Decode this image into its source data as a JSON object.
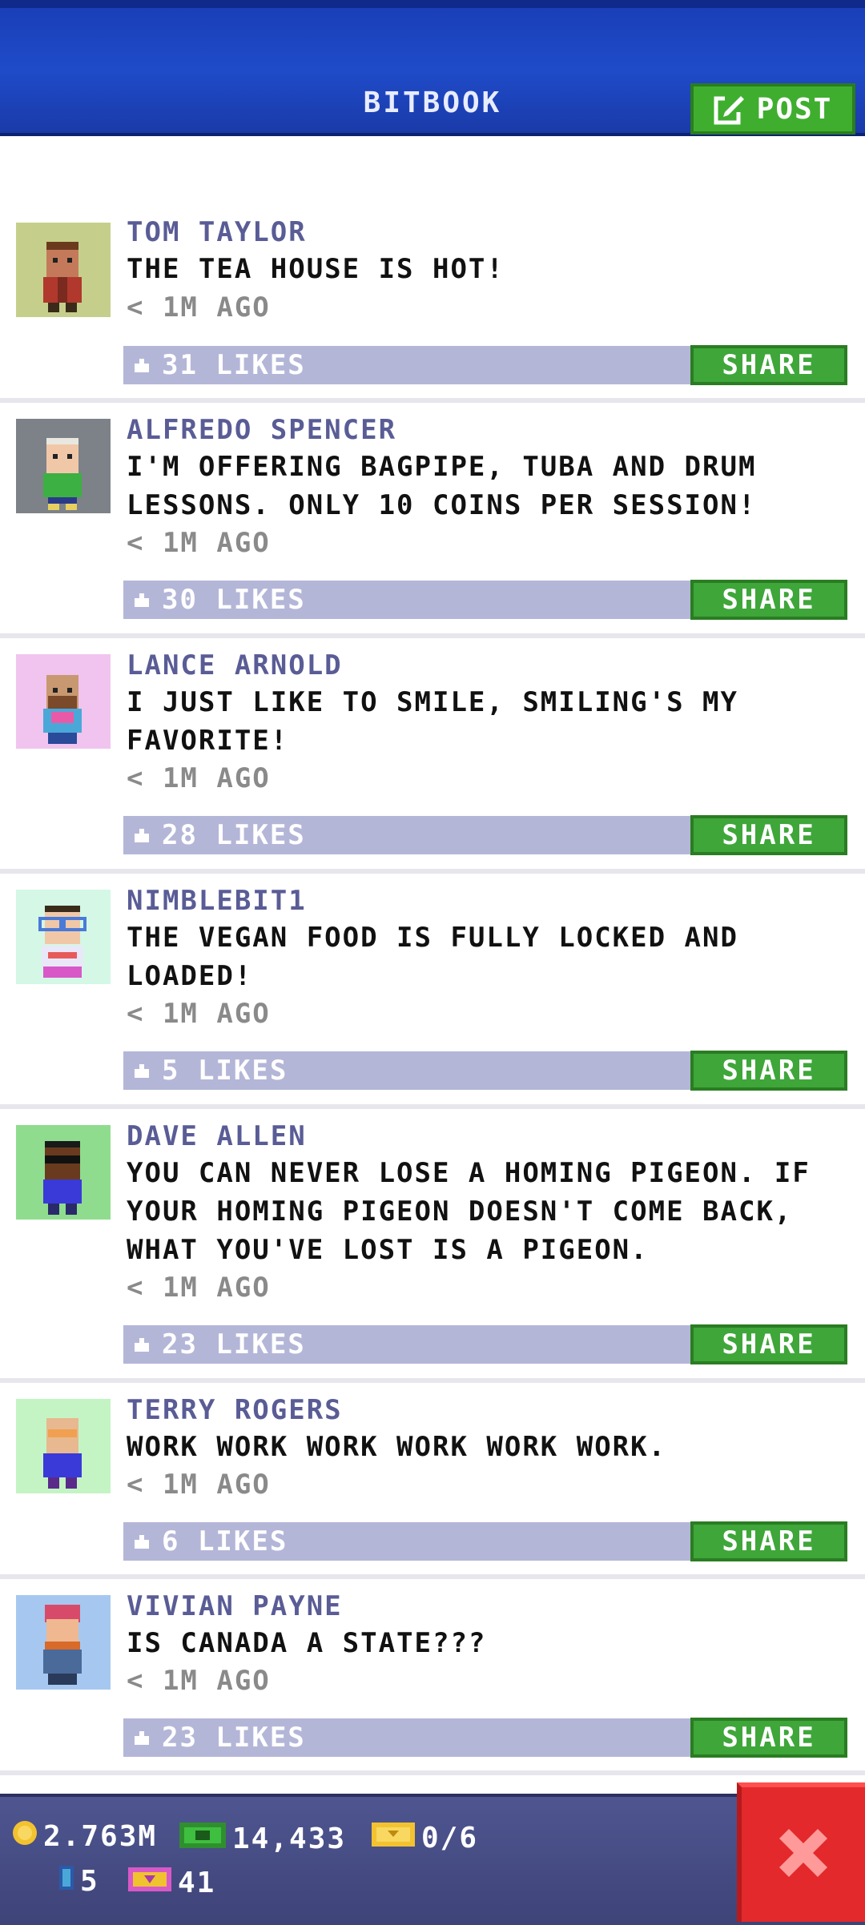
{
  "header": {
    "title": "BITBOOK",
    "post_label": "POST"
  },
  "posts": [
    {
      "name": "TOM TAYLOR",
      "message": "THE TEA HOUSE IS HOT!",
      "time": "< 1M AGO",
      "likes": "31 LIKES",
      "share": "SHARE",
      "avatar_bg": "#c5cf8b"
    },
    {
      "name": "ALFREDO SPENCER",
      "message": "I'M OFFERING BAGPIPE, TUBA AND DRUM\nLESSONS. ONLY 10 COINS PER SESSION!",
      "time": "< 1M AGO",
      "likes": "30 LIKES",
      "share": "SHARE",
      "avatar_bg": "#7c8288"
    },
    {
      "name": "LANCE ARNOLD",
      "message": "I JUST LIKE TO SMILE, SMILING'S MY\nFAVORITE!",
      "time": "< 1M AGO",
      "likes": "28 LIKES",
      "share": "SHARE",
      "avatar_bg": "#f0c4ee"
    },
    {
      "name": "NIMBLEBIT1",
      "message": "THE VEGAN FOOD IS FULLY LOCKED AND\nLOADED!",
      "time": "< 1M AGO",
      "likes": "5 LIKES",
      "share": "SHARE",
      "avatar_bg": "#d4f7e6"
    },
    {
      "name": "DAVE ALLEN",
      "message": "YOU CAN NEVER LOSE A HOMING PIGEON. IF\nYOUR HOMING PIGEON DOESN'T COME BACK,\nWHAT YOU'VE LOST IS A PIGEON.",
      "time": "< 1M AGO",
      "likes": "23 LIKES",
      "share": "SHARE",
      "avatar_bg": "#8fdc8f"
    },
    {
      "name": "TERRY ROGERS",
      "message": "WORK WORK WORK WORK WORK WORK.",
      "time": "< 1M AGO",
      "likes": "6 LIKES",
      "share": "SHARE",
      "avatar_bg": "#c4f4c4"
    },
    {
      "name": "VIVIAN PAYNE",
      "message": "IS CANADA A STATE???",
      "time": "< 1M AGO",
      "likes": "23 LIKES",
      "share": "SHARE",
      "avatar_bg": "#a6c8f0"
    }
  ],
  "bottom_bar": {
    "coins": "2.763M",
    "bux": "14,433",
    "tickets": "0/6",
    "elevators": "5",
    "gems": "41"
  },
  "colors": {
    "header": "#1f4bc9",
    "accent_green": "#3fae2f",
    "likes_bar": "#b4b6d8",
    "close_red": "#e3292b"
  }
}
